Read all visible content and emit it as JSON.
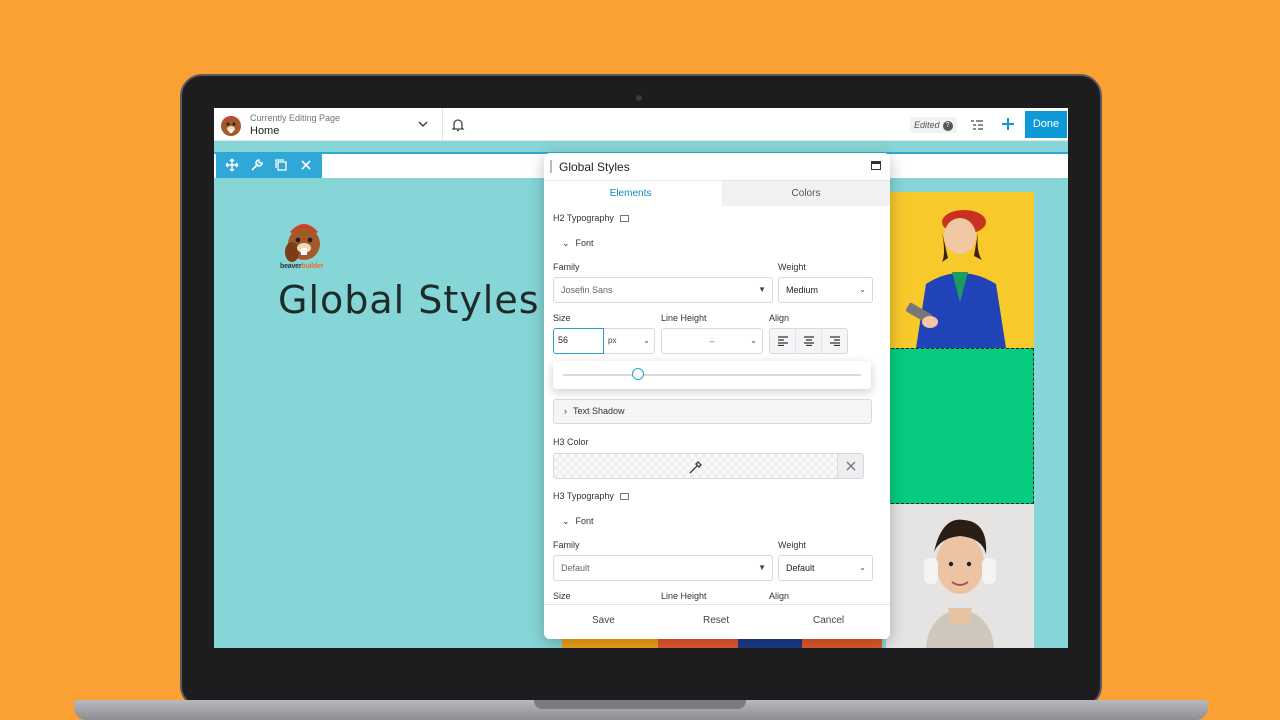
{
  "topbar": {
    "editing_label": "Currently Editing Page",
    "page_name": "Home",
    "edited_label": "Edited",
    "help_glyph": "?",
    "done_label": "Done"
  },
  "content": {
    "logo_text_a": "beaver",
    "logo_text_b": "builder",
    "title": "Global Styles"
  },
  "panel": {
    "title": "Global Styles",
    "tabs": [
      "Elements",
      "Colors"
    ],
    "h2": {
      "heading": "H2 Typography",
      "font_toggle": "Font",
      "family_label": "Family",
      "family_value": "Josefin Sans",
      "weight_label": "Weight",
      "weight_value": "Medium",
      "size_label": "Size",
      "size_value": "56",
      "unit_value": "px",
      "line_height_label": "Line Height",
      "line_height_value": "–",
      "align_label": "Align",
      "text_shadow_label": "Text Shadow",
      "slider_level": 0.25
    },
    "h3_color_label": "H3 Color",
    "h3": {
      "heading": "H3 Typography",
      "font_toggle": "Font",
      "family_label": "Family",
      "family_value": "Default",
      "weight_label": "Weight",
      "weight_value": "Default",
      "size_label": "Size",
      "line_height_label": "Line Height",
      "align_label": "Align"
    },
    "footer": {
      "save": "Save",
      "reset": "Reset",
      "cancel": "Cancel"
    }
  },
  "colors": {
    "background": "#fba033",
    "canvas": "#86d5d7",
    "accent": "#0e9ad6",
    "green_block": "#07cc7f"
  },
  "icons": [
    "beaver-logo-icon",
    "chevron-down-icon",
    "bell-icon",
    "help-icon",
    "outline-list-icon",
    "plus-icon",
    "move-icon",
    "wrench-icon",
    "duplicate-icon",
    "close-icon",
    "monitor-icon",
    "maximize-icon",
    "align-left-icon",
    "align-center-icon",
    "align-right-icon",
    "eyedropper-icon",
    "chevron-right-icon"
  ]
}
